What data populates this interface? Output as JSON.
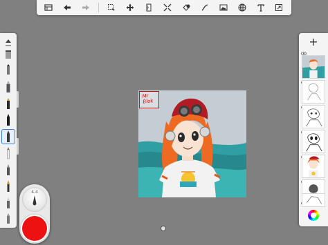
{
  "toolbar": {
    "buttons": [
      {
        "name": "gallery-icon"
      },
      {
        "name": "undo-icon"
      },
      {
        "name": "redo-icon"
      },
      {
        "name": "select-icon"
      },
      {
        "name": "transform-icon"
      },
      {
        "name": "ruler-icon"
      },
      {
        "name": "symmetry-icon"
      },
      {
        "name": "fill-icon"
      },
      {
        "name": "shape-icon"
      },
      {
        "name": "image-import-icon"
      },
      {
        "name": "perspective-icon"
      },
      {
        "name": "text-icon"
      },
      {
        "name": "fullscreen-icon"
      }
    ]
  },
  "brush_palette": {
    "selected_index": 7
  },
  "puck": {
    "brush_size": "4.4",
    "color": "#ee1111"
  },
  "canvas": {
    "signature": [
      "Mr",
      "Blok"
    ]
  },
  "layers": {
    "add_label": "+",
    "items": [
      {
        "name": "layer-1-thumbnail",
        "selected": false
      },
      {
        "name": "layer-2-thumbnail",
        "selected": false
      },
      {
        "name": "layer-3-thumbnail",
        "selected": false
      },
      {
        "name": "layer-4-thumbnail",
        "selected": false
      },
      {
        "name": "layer-5-thumbnail",
        "selected": false
      },
      {
        "name": "layer-6-thumbnail",
        "selected": false
      },
      {
        "name": "layer-7-thumbnail",
        "selected": false
      }
    ]
  },
  "colors": {
    "background": "#808080",
    "accent": "#3a7de0",
    "brush_color": "#ee1111"
  }
}
